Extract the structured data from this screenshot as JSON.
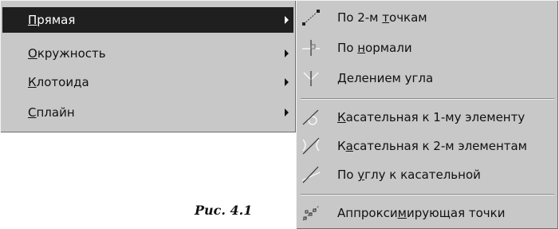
{
  "main_menu": {
    "items": [
      {
        "pre": "",
        "key": "П",
        "post": "рямая",
        "selected": true
      },
      {
        "pre": "",
        "key": "О",
        "post": "кружность",
        "selected": false
      },
      {
        "pre": "",
        "key": "К",
        "post": "лотоида",
        "selected": false
      },
      {
        "pre": "",
        "key": "С",
        "post": "плайн",
        "selected": false
      }
    ]
  },
  "submenu": {
    "items": [
      {
        "pre": "По 2-м ",
        "key": "т",
        "post": "очкам",
        "icon": "line-two-points-icon"
      },
      {
        "pre": "По ",
        "key": "н",
        "post": "ормали",
        "icon": "normal-line-icon"
      },
      {
        "pre": "",
        "key": "Д",
        "post": "елением угла",
        "icon": "angle-bisector-icon"
      },
      {
        "pre": "",
        "key": "К",
        "post": "асательная к 1-му элементу",
        "icon": "tangent-one-element-icon"
      },
      {
        "pre": "К",
        "key": "а",
        "post": "сательная к 2-м элементам",
        "icon": "tangent-two-elements-icon"
      },
      {
        "pre": "По ",
        "key": "у",
        "post": "глу к касательной",
        "icon": "angle-to-tangent-icon"
      },
      {
        "pre": "Аппрокси",
        "key": "м",
        "post": "ирующая точки",
        "icon": "approximating-points-icon"
      }
    ]
  },
  "caption": "Рис. 4.1"
}
